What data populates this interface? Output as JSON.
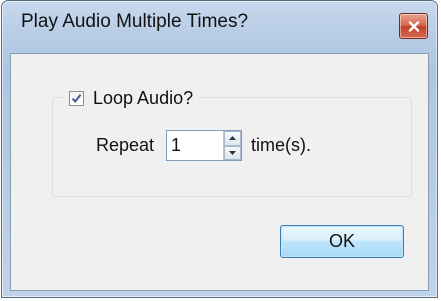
{
  "window": {
    "title": "Play Audio Multiple Times?"
  },
  "group": {
    "checkbox_label": "Loop Audio?",
    "checked": true
  },
  "repeat": {
    "label": "Repeat",
    "value": "1",
    "unit": "time(s)."
  },
  "buttons": {
    "ok": "OK"
  },
  "icons": {
    "close": "close-icon",
    "check": "checkmark-icon",
    "spin_up": "spin-up-arrow-icon",
    "spin_down": "spin-down-arrow-icon"
  },
  "colors": {
    "close_button": "#c1412a",
    "check_mark": "#3f5e8f",
    "ok_button_border": "#3c7fb1"
  }
}
